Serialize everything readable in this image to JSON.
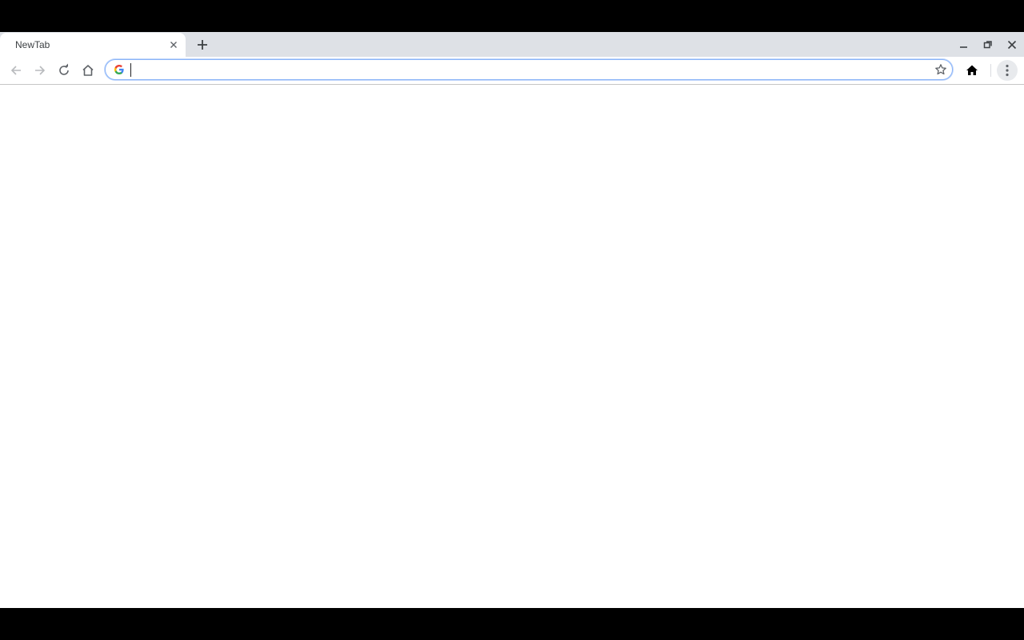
{
  "tabs": [
    {
      "title": "NewTab",
      "close_icon": "close-icon"
    }
  ],
  "tabstrip": {
    "new_tab_icon": "plus-icon"
  },
  "window_controls": {
    "minimize_icon": "minimize-icon",
    "restore_icon": "restore-icon",
    "close_icon": "close-icon"
  },
  "toolbar": {
    "back_icon": "arrow-left-icon",
    "forward_icon": "arrow-right-icon",
    "reload_icon": "reload-icon",
    "home_icon": "home-outline-icon",
    "bookmark_icon": "star-outline-icon",
    "home_extension_icon": "home-filled-icon",
    "menu_icon": "kebab-menu-icon"
  },
  "omnibox": {
    "value": "",
    "placeholder": "",
    "search_engine_icon": "google-g-icon"
  },
  "colors": {
    "tabstrip_bg": "#dee1e6",
    "active_tab_bg": "#ffffff",
    "omnibox_focus_border": "#8ab4f8",
    "icon_default": "#5f6368",
    "icon_disabled": "#b8babd"
  }
}
